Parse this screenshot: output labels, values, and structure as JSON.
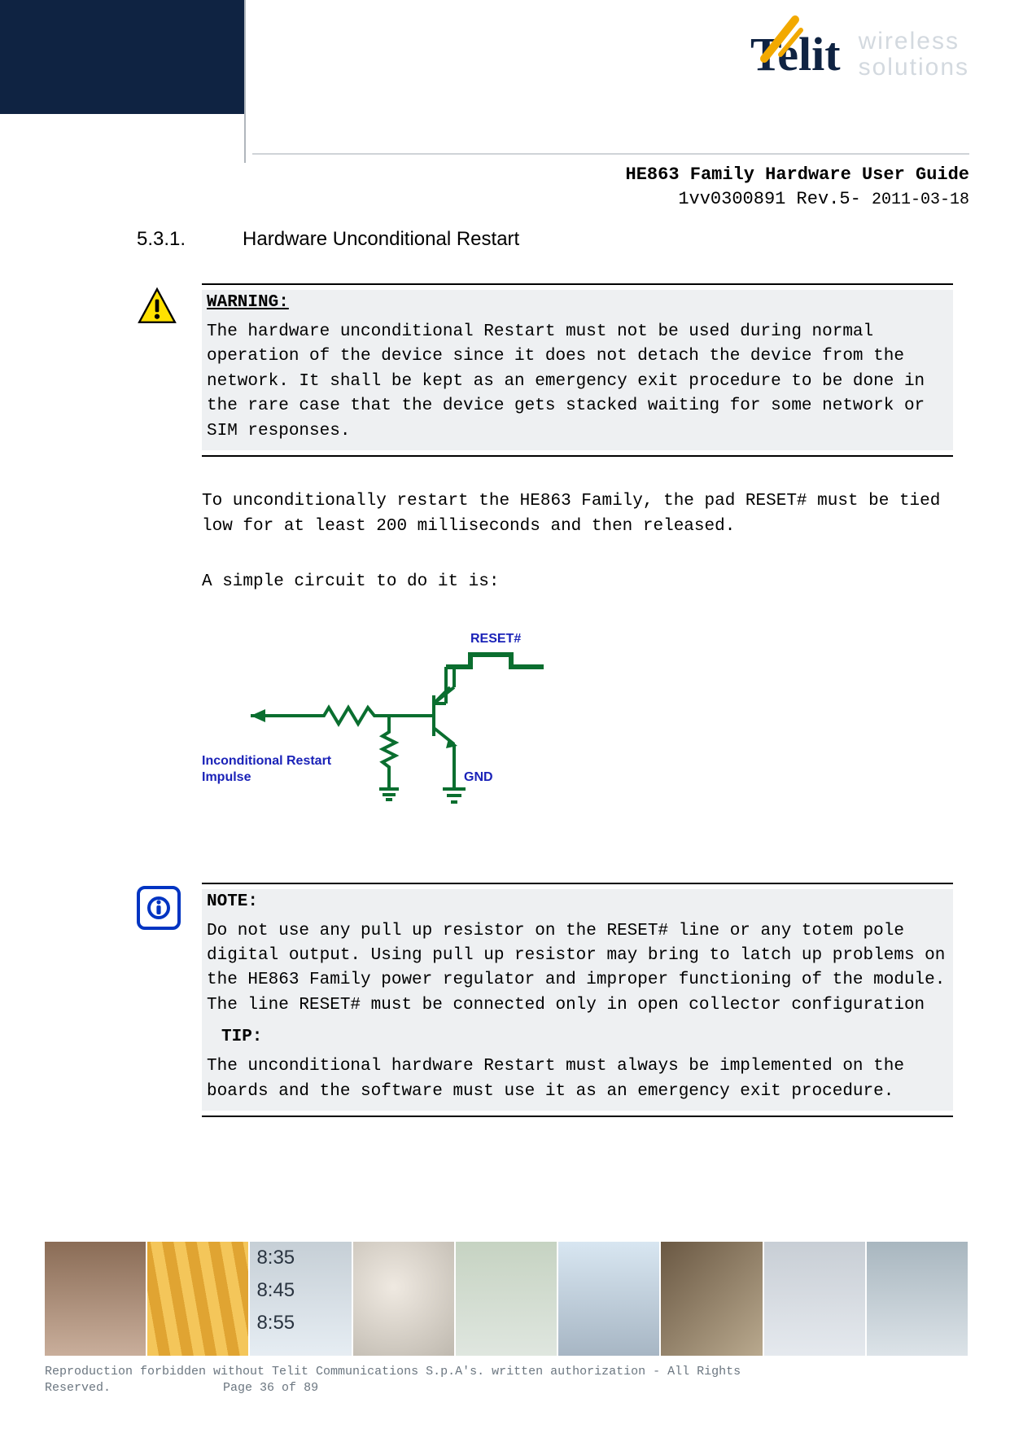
{
  "header": {
    "brand": "Telit",
    "brand_sub1": "wireless",
    "brand_sub2": "solutions",
    "doc_title": "HE863 Family Hardware User Guide",
    "doc_rev": "1vv0300891 Rev.5- ",
    "doc_date": "2011-03-18"
  },
  "section": {
    "number": "5.3.1.",
    "title": "Hardware Unconditional Restart"
  },
  "warning": {
    "head": "WARNING:",
    "body": "The hardware unconditional Restart must not be used during normal operation of the device since it does not detach the device from the network. It shall be kept as an emergency exit procedure to be done in the rare case that the device gets stacked waiting for some network or SIM responses."
  },
  "para1": "To unconditionally restart the HE863 Family, the pad RESET# must be tied low for at least 200 milliseconds and then released.",
  "para2": "A simple circuit to do it is:",
  "circuit": {
    "label_reset": "RESET#",
    "label_gnd": "GND",
    "label_input1": "Inconditional Restart",
    "label_input2": "Impulse"
  },
  "note": {
    "head": "NOTE:",
    "body": "Do not use any pull up resistor on the RESET# line or any totem pole digital output. Using pull up resistor may bring to latch up problems on the HE863 Family power regulator and improper functioning of the module. The line RESET# must be connected only in open collector configuration",
    "tip_head": "TIP:",
    "tip_body": "The unconditional hardware Restart must always be implemented on the boards and the software must use it as an emergency exit procedure."
  },
  "footer": {
    "line1": "Reproduction forbidden without Telit Communications S.p.A's. written authorization - All Rights",
    "line2_left": "Reserved.",
    "line2_right": "Page 36 of 89"
  }
}
